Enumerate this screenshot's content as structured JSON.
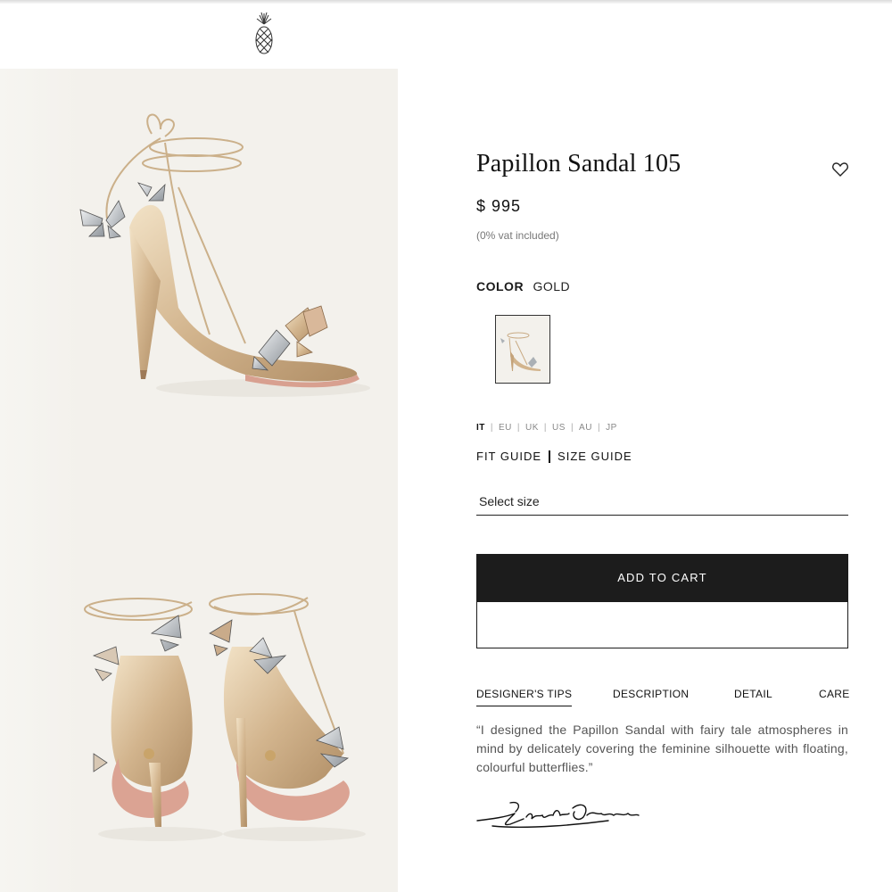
{
  "brand": {
    "logo": "pineapple-logo-icon"
  },
  "product": {
    "title": "Papillon Sandal 105",
    "price": "$ 995",
    "vat_note": "(0% vat included)",
    "color_label": "COLOR",
    "color_value": "GOLD",
    "swatch": "gold-sandal-thumbnail"
  },
  "sizing": {
    "systems": [
      "IT",
      "EU",
      "UK",
      "US",
      "AU",
      "JP"
    ],
    "active_system": "IT",
    "fit_guide": "FIT GUIDE",
    "size_guide": "SIZE GUIDE",
    "select_placeholder": "Select size"
  },
  "actions": {
    "add_to_cart": "ADD TO CART",
    "wishlist_icon": "heart-icon"
  },
  "tabs": [
    {
      "label": "DESIGNER'S TIPS",
      "active": true
    },
    {
      "label": "DESCRIPTION",
      "active": false
    },
    {
      "label": "DETAIL",
      "active": false
    },
    {
      "label": "CARE",
      "active": false
    }
  ],
  "tab_content": {
    "quote": "“I designed the Papillon Sandal with fairy tale atmospheres in mind by delicately covering the feminine silhouette with floating, colourful butterflies.”",
    "signature": "Edgardo Osorio"
  },
  "gallery": {
    "images": [
      "sandal-side-view",
      "sandal-back-pair-view"
    ]
  },
  "colors": {
    "accent": "#1c1c1c",
    "gallery_bg": "#f3f1ec",
    "muted_text": "#777777"
  }
}
